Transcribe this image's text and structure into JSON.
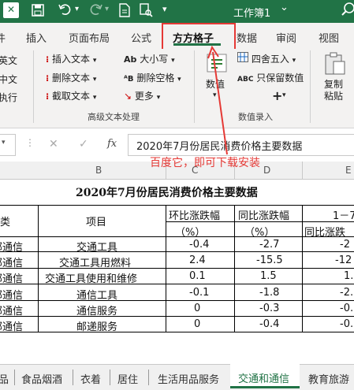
{
  "titlebar": {
    "close_glyph": "✕",
    "workbook_title": "工作簿1",
    "title_chevron": "⌄",
    "accent": "#217346"
  },
  "tabs": [
    "插入",
    "页面布局",
    "公式",
    "方方格子",
    "数据",
    "审阅",
    "视图"
  ],
  "tabs_partial_left": "件",
  "ribbon": {
    "left_partial": [
      "英文",
      "中文",
      "执行"
    ],
    "text_group": {
      "items": [
        "插入文本",
        "删除文本",
        "截取文本",
        "大小写",
        "删除空格",
        "更多"
      ],
      "label": "高级文本处理"
    },
    "num_group": {
      "items": [
        "四舍五入",
        "只保留数值"
      ],
      "plus": "+",
      "dropdown": "▾",
      "big_button": "数值",
      "label": "数值录入",
      "abc_prefix": "ABC"
    },
    "copy_paste": "复制粘贴"
  },
  "formula_bar": {
    "fx": "fx",
    "cancel": "✕",
    "confirm": "✓",
    "formula": "2020年7月份居民消费价格主要数据"
  },
  "annotation": "百度它，即可下载安装",
  "columns": [
    "B",
    "C",
    "D",
    "E"
  ],
  "table": {
    "title": "2020年7月份居民消费价格主要数据",
    "header": {
      "category": "类",
      "item": "项目",
      "mom": "环比涨跌幅",
      "yoy": "同比涨跌幅",
      "ytd": "1－7",
      "pct": "（%）",
      "ytd_sub": "同比涨跌"
    },
    "rows": [
      {
        "cat": "邮通信",
        "item": "交通工具",
        "mom": "-0.4",
        "yoy": "-2.7",
        "e": "-2"
      },
      {
        "cat": "邮通信",
        "item": "交通工具用燃料",
        "mom": "2.4",
        "yoy": "-15.5",
        "e": "-12"
      },
      {
        "cat": "邮通信",
        "item": "交通工具使用和维修",
        "mom": "0.1",
        "yoy": "1.5",
        "e": "1."
      },
      {
        "cat": "邮通信",
        "item": "通信工具",
        "mom": "-0.1",
        "yoy": "-1.8",
        "e": "-2."
      },
      {
        "cat": "邮通信",
        "item": "通信服务",
        "mom": "0",
        "yoy": "-0.3",
        "e": "-0."
      },
      {
        "cat": "邮通信",
        "item": "邮递服务",
        "mom": "0",
        "yoy": "-0.4",
        "e": "-0."
      }
    ]
  },
  "sheet_tabs": [
    "品",
    "食品烟酒",
    "衣着",
    "居住",
    "生活用品服务",
    "交通和通信",
    "教育旅游"
  ],
  "active_sheet": "交通和通信"
}
